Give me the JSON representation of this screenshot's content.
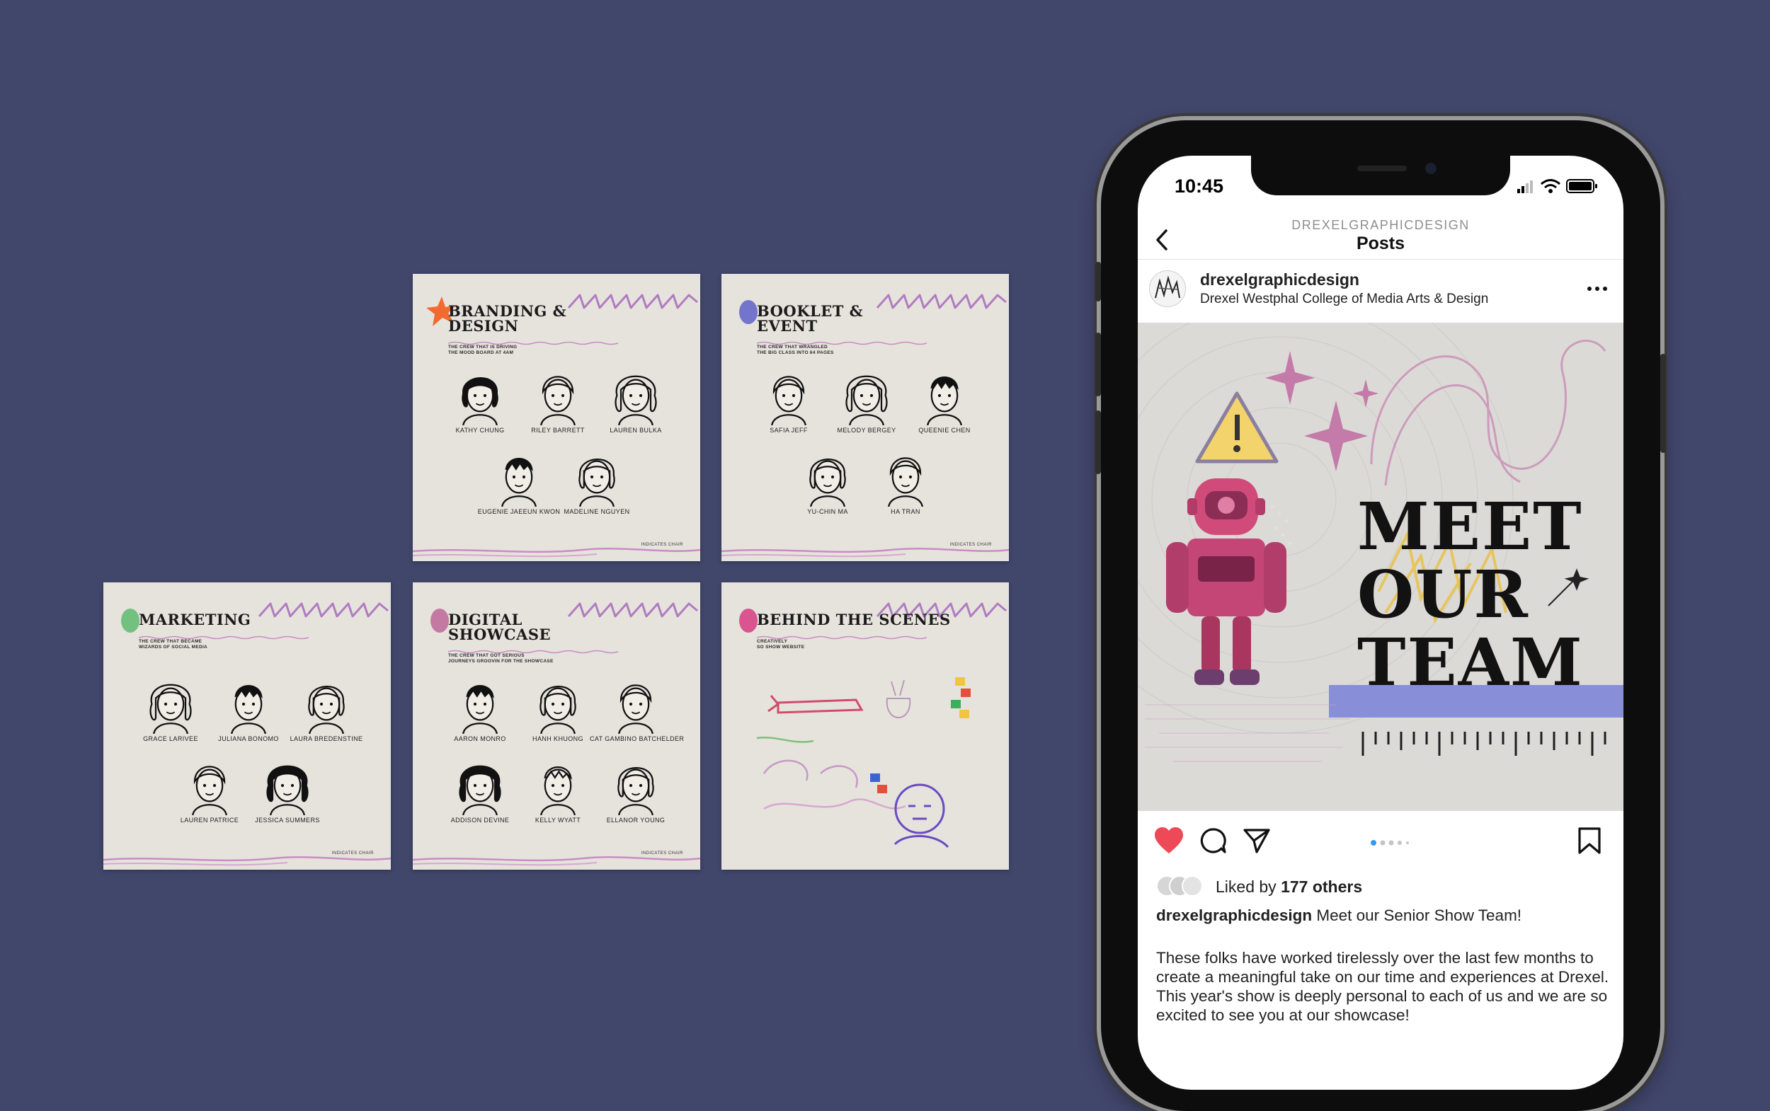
{
  "cards": [
    {
      "title": "BRANDING &\nDESIGN",
      "subtitle": "THE CREW THAT IS DRIVING\nTHE MOOD BOARD AT 4AM",
      "accent": "#f26a2e",
      "members": [
        "KATHY CHUNG",
        "RILEY BARRETT",
        "LAUREN BULKA",
        "EUGENIE JAEEUN KWON",
        "MADELINE NGUYEN"
      ],
      "footer": "INDICATES CHAIR"
    },
    {
      "title": "BOOKLET &\nEVENT",
      "subtitle": "THE CREW THAT WRANGLED\nTHE BIG CLASS INTO 64 PAGES",
      "accent": "#6c6fc9",
      "members": [
        "SAFIA JEFF",
        "MELODY BERGEY",
        "QUEENIE CHEN",
        "YU-CHIN MA",
        "HA TRAN"
      ],
      "footer": "INDICATES CHAIR"
    },
    {
      "title": "MARKETING",
      "subtitle": "THE CREW THAT BECAME\nWIZARDS OF SOCIAL MEDIA",
      "accent": "#6dbf7b",
      "members": [
        "GRACE LARIVEE",
        "JULIANA BONOMO",
        "LAURA BREDENSTINE",
        "LAUREN PATRICE",
        "JESSICA SUMMERS"
      ],
      "footer": "INDICATES CHAIR"
    },
    {
      "title": "DIGITAL\nSHOWCASE",
      "subtitle": "THE CREW THAT GOT SERIOUS\nJOURNEYS GROOVIN FOR THE SHOWCASE",
      "accent": "#c2739e",
      "members": [
        "AARON MONRO",
        "HANH KHUONG",
        "CAT GAMBINO BATCHELDER",
        "ADDISON DEVINE",
        "KELLY WYATT",
        "ELLANOR YOUNG"
      ],
      "footer": "INDICATES CHAIR"
    },
    {
      "title": "BEHIND THE SCENES",
      "subtitle": "CREATIVELY\nSO SHOW WEBSITE",
      "accent": "#d94c8a",
      "members": [],
      "footer": ""
    }
  ],
  "phone": {
    "time": "10:45",
    "nav_handle": "DREXELGRAPHICDESIGN",
    "nav_title": "Posts",
    "account": "drexelgraphicdesign",
    "account_sub": "Drexel Westphal College of Media Arts & Design",
    "poster_text": "MEET\nOUR\nTEAM",
    "liked_prefix": "Liked by ",
    "liked_count": "177 others",
    "caption_user": "drexelgraphicdesign",
    "caption_text": " Meet our Senior Show Team!",
    "caption_body": "These folks have worked tirelessly over the last few months to create a meaningful take on our time and experiences at Drexel. This year's show is deeply personal to each of us and we are so excited to see you at our showcase!"
  },
  "colors": {
    "background": "#41466b",
    "card": "#e6e3dd",
    "heart": "#ed4956",
    "carousel_active": "#3897f0"
  }
}
